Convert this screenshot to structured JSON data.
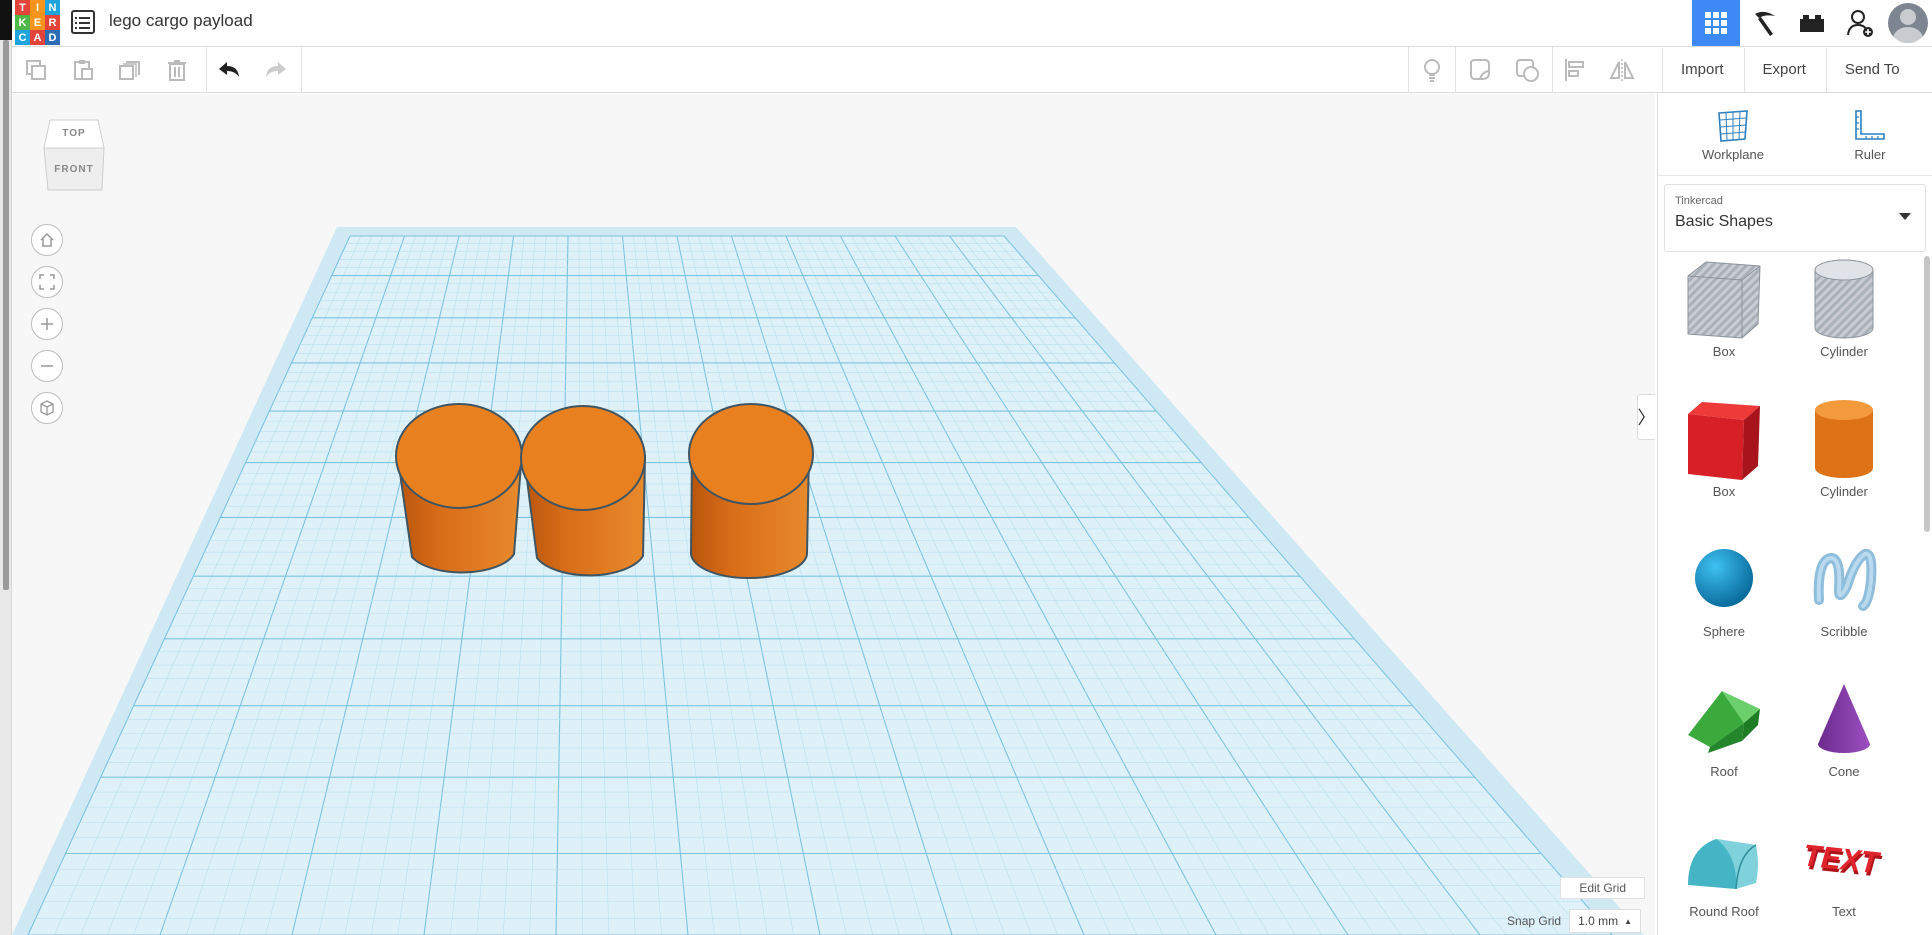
{
  "header": {
    "logo_letters": [
      "T",
      "I",
      "N",
      "K",
      "E",
      "R",
      "C",
      "A",
      "D"
    ],
    "project_title": "lego cargo payload",
    "icons": [
      "grid-icon",
      "pickaxe-icon",
      "brick-icon",
      "add-user-icon",
      "avatar"
    ]
  },
  "toolbar": {
    "tools": [
      "copy-icon",
      "paste-icon",
      "duplicate-icon",
      "trash-icon",
      "undo-icon",
      "redo-icon"
    ],
    "right_tools": [
      "lightbulb-icon",
      "note-icon",
      "group-icon",
      "align-icon",
      "mirror-icon"
    ]
  },
  "actions": {
    "import": "Import",
    "export": "Export",
    "send_to": "Send To"
  },
  "viewcube": {
    "top": "TOP",
    "front": "FRONT"
  },
  "nav": [
    "home-icon",
    "fit-icon",
    "zoom-in-icon",
    "zoom-out-icon",
    "perspective-icon"
  ],
  "viewport": {
    "edit_grid": "Edit Grid",
    "snap_grid_label": "Snap Grid",
    "snap_grid_value": "1.0 mm"
  },
  "panel": {
    "workplane": "Workplane",
    "ruler": "Ruler",
    "library_small": "Tinkercad",
    "library_name": "Basic Shapes",
    "shapes": [
      {
        "label": "Box",
        "kind": "hole-box"
      },
      {
        "label": "Cylinder",
        "kind": "hole-cylinder"
      },
      {
        "label": "Box",
        "kind": "box"
      },
      {
        "label": "Cylinder",
        "kind": "cylinder"
      },
      {
        "label": "Sphere",
        "kind": "sphere"
      },
      {
        "label": "Scribble",
        "kind": "scribble"
      },
      {
        "label": "Roof",
        "kind": "roof"
      },
      {
        "label": "Cone",
        "kind": "cone"
      },
      {
        "label": "Round Roof",
        "kind": "round-roof"
      },
      {
        "label": "Text",
        "kind": "text"
      }
    ]
  },
  "scene": {
    "objects": [
      "cylinder-1",
      "cylinder-2",
      "cylinder-3"
    ],
    "object_color": "#e88020"
  },
  "colors": {
    "accent": "#3d8af7",
    "grid": "#7cc3e1",
    "orange": "#e88020"
  }
}
